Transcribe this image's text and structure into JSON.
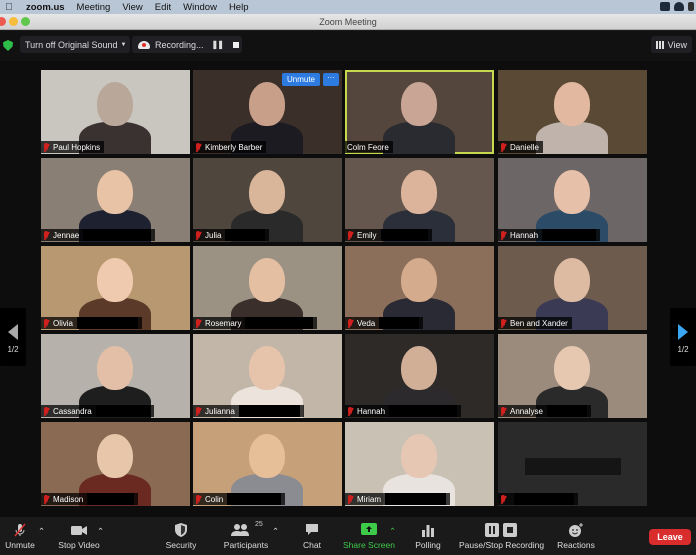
{
  "menubar": {
    "app": "zoom.us",
    "items": [
      "Meeting",
      "View",
      "Edit",
      "Window",
      "Help"
    ]
  },
  "window": {
    "title": "Zoom Meeting"
  },
  "topbar": {
    "sound_label": "Turn off Original Sound",
    "recording_label": "Recording...",
    "view_label": "View"
  },
  "tile_controls": {
    "unmute_label": "Unmute",
    "more_label": "···"
  },
  "pagination": {
    "left": "1/2",
    "right": "1/2"
  },
  "participants": [
    {
      "name": "Paul Hopkins",
      "muted": true
    },
    {
      "name": "Kimberly Barber",
      "muted": true
    },
    {
      "name": "Colm Feore",
      "muted": false,
      "active_speaker": true
    },
    {
      "name": "Danielle",
      "muted": true
    },
    {
      "name": "Jennae",
      "muted": true
    },
    {
      "name": "Julia",
      "muted": true
    },
    {
      "name": "Emily",
      "muted": true
    },
    {
      "name": "Hannah",
      "muted": true
    },
    {
      "name": "Olivia",
      "muted": true
    },
    {
      "name": "Rosemary",
      "muted": true
    },
    {
      "name": "Veda",
      "muted": true
    },
    {
      "name": "Ben and Xander",
      "muted": true
    },
    {
      "name": "Cassandra",
      "muted": true
    },
    {
      "name": "Julianna",
      "muted": true
    },
    {
      "name": "Hannah",
      "muted": true
    },
    {
      "name": "Annalyse",
      "muted": true
    },
    {
      "name": "Madison",
      "muted": true
    },
    {
      "name": "Colin",
      "muted": true
    },
    {
      "name": "Miriam",
      "muted": true
    },
    {
      "name": "",
      "muted": true,
      "video_off": true
    }
  ],
  "toolbar": {
    "unmute": "Unmute",
    "stop_video": "Stop Video",
    "security": "Security",
    "participants": "Participants",
    "participants_count": "25",
    "chat": "Chat",
    "share_screen": "Share Screen",
    "polling": "Polling",
    "pause_stop_recording": "Pause/Stop Recording",
    "reactions": "Reactions",
    "leave": "Leave"
  },
  "colors": {
    "active_speaker": "#c6d94d",
    "accent_blue": "#2d7ae0",
    "share_green": "#3ecb4a",
    "leave_red": "#d92c2c",
    "mute_red": "#d0201e"
  }
}
